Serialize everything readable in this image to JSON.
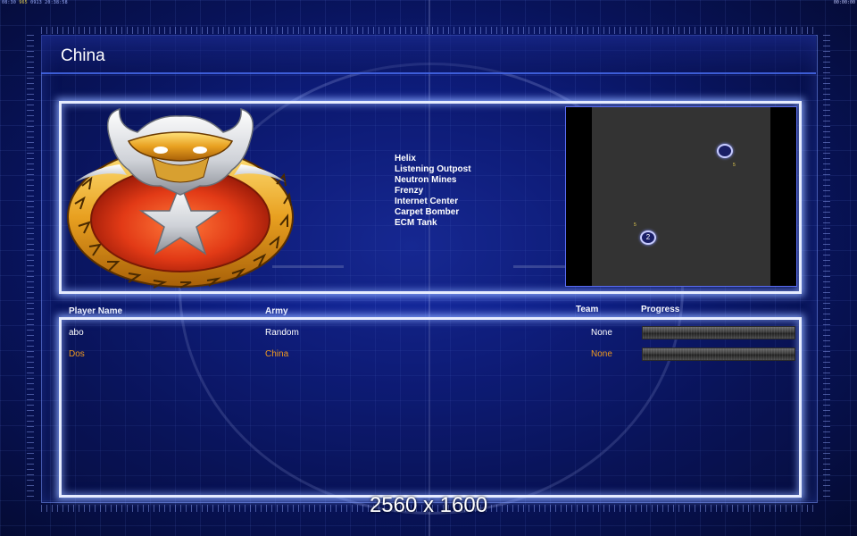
{
  "status_bar": {
    "left_prefix": "08:30 ",
    "left_highlight": "965",
    "left_suffix": " 0913 20:38:58",
    "right": "00:00:00"
  },
  "faction": {
    "title": "China"
  },
  "units": [
    "Helix",
    "Listening Outpost",
    "Neutron Mines",
    "Frenzy",
    "Internet Center",
    "Carpet Bomber",
    "ECM Tank"
  ],
  "map_preview": {
    "start_positions": [
      {
        "label": ""
      },
      {
        "label": "2"
      }
    ],
    "markers": [
      "5",
      "5"
    ]
  },
  "players_table": {
    "headers": {
      "player_name": "Player Name",
      "army": "Army",
      "team": "Team",
      "progress": "Progress"
    },
    "rows": [
      {
        "name": "abo",
        "army": "Random",
        "team": "None",
        "progress": 0
      },
      {
        "name": "Dos",
        "army": "China",
        "team": "None",
        "progress": 0
      }
    ]
  },
  "overlay": {
    "resolution": "2560 x 1600"
  },
  "colors": {
    "background": "#0f1f86",
    "panel_glow": "#e6ecff",
    "local_player": "#f09a20",
    "text": "#ffffff"
  }
}
